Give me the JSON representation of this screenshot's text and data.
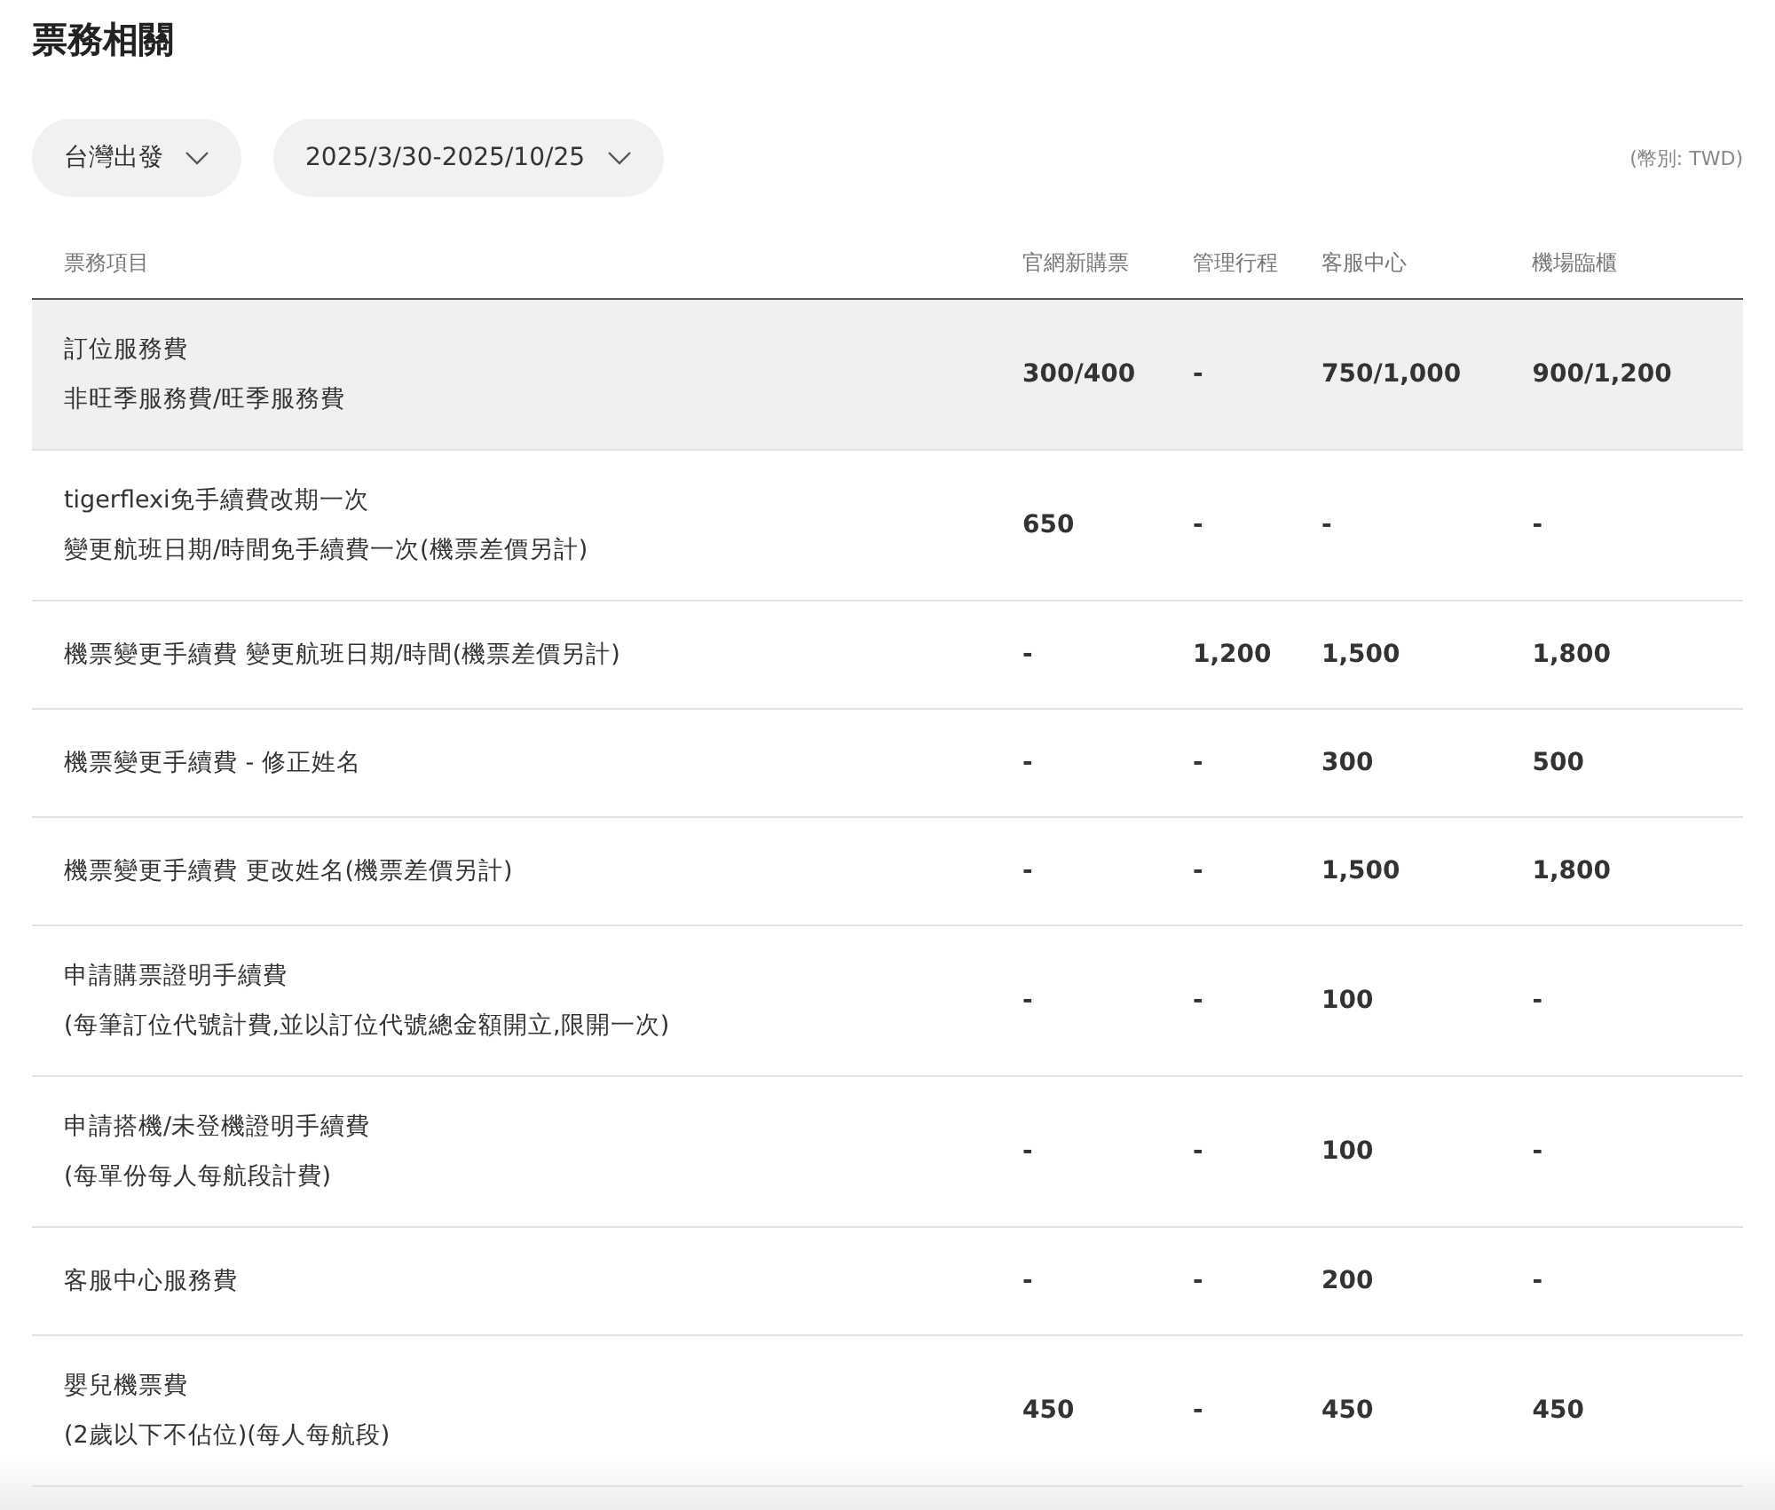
{
  "title": "票務相關",
  "filters": [
    {
      "label": "台灣出發"
    },
    {
      "label": "2025/3/30-2025/10/25"
    }
  ],
  "currency_note": "(幣別: TWD)",
  "table": {
    "columns": [
      "票務項目",
      "官網新購票",
      "管理行程",
      "客服中心",
      "機場臨櫃"
    ],
    "rows": [
      {
        "lines": [
          "訂位服務費",
          "非旺季服務費/旺季服務費"
        ],
        "values": [
          "300/400",
          "-",
          "750/1,000",
          "900/1,200"
        ],
        "highlighted": true
      },
      {
        "lines": [
          "tigerflexi免手續費改期一次",
          "變更航班日期/時間免手續費一次(機票差價另計)"
        ],
        "values": [
          "650",
          "-",
          "-",
          "-"
        ],
        "highlighted": false
      },
      {
        "lines": [
          "機票變更手續費 變更航班日期/時間(機票差價另計)"
        ],
        "values": [
          "-",
          "1,200",
          "1,500",
          "1,800"
        ],
        "highlighted": false
      },
      {
        "lines": [
          "機票變更手續費 - 修正姓名"
        ],
        "values": [
          "-",
          "-",
          "300",
          "500"
        ],
        "highlighted": false
      },
      {
        "lines": [
          "機票變更手續費 更改姓名(機票差價另計)"
        ],
        "values": [
          "-",
          "-",
          "1,500",
          "1,800"
        ],
        "highlighted": false
      },
      {
        "lines": [
          "申請購票證明手續費",
          "(每筆訂位代號計費,並以訂位代號總金額開立,限開一次)"
        ],
        "values": [
          "-",
          "-",
          "100",
          "-"
        ],
        "highlighted": false
      },
      {
        "lines": [
          "申請搭機/未登機證明手續費",
          "(每單份每人每航段計費)"
        ],
        "values": [
          "-",
          "-",
          "100",
          "-"
        ],
        "highlighted": false
      },
      {
        "lines": [
          "客服中心服務費"
        ],
        "values": [
          "-",
          "-",
          "200",
          "-"
        ],
        "highlighted": false
      },
      {
        "lines": [
          "嬰兒機票費",
          "(2歲以下不佔位)(每人每航段)"
        ],
        "values": [
          "450",
          "-",
          "450",
          "450"
        ],
        "highlighted": false
      }
    ]
  }
}
